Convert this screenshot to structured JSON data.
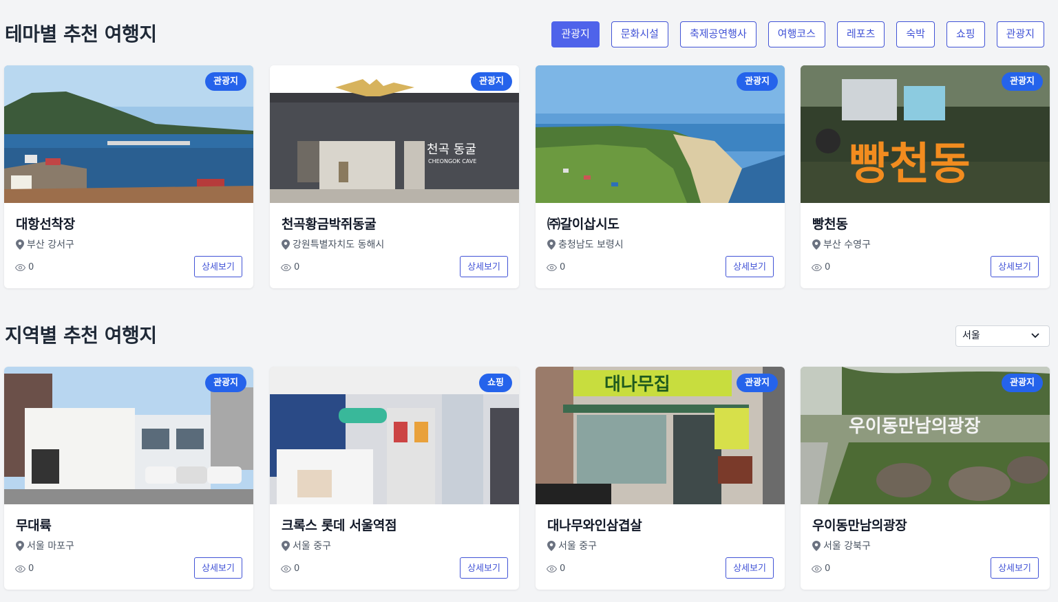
{
  "theme_section": {
    "title": "테마별 추천 여행지",
    "filters": [
      "관광지",
      "문화시설",
      "축제공연행사",
      "여행코스",
      "레포츠",
      "숙박",
      "쇼핑",
      "관광지"
    ],
    "active_filter_index": 0,
    "cards": [
      {
        "name": "대항선착장",
        "location": "부산 강서구",
        "badge": "관광지",
        "views": "0",
        "detail": "상세보기"
      },
      {
        "name": "천곡황금박쥐동굴",
        "location": "강원특별자치도 동해시",
        "badge": "관광지",
        "views": "0",
        "detail": "상세보기",
        "sign_text": "천곡 동굴",
        "sign_sub": "CHEONGOK CAVE"
      },
      {
        "name": "㈜갈이삽시도",
        "location": "충청남도 보령시",
        "badge": "관광지",
        "views": "0",
        "detail": "상세보기"
      },
      {
        "name": "빵천동",
        "location": "부산 수영구",
        "badge": "관광지",
        "views": "0",
        "detail": "상세보기",
        "sign_text": "빵천동"
      }
    ]
  },
  "region_section": {
    "title": "지역별 추천 여행지",
    "select_value": "서울",
    "cards": [
      {
        "name": "무대륙",
        "location": "서울 마포구",
        "badge": "관광지",
        "views": "0",
        "detail": "상세보기"
      },
      {
        "name": "크록스 롯데 서울역점",
        "location": "서울 중구",
        "badge": "쇼핑",
        "views": "0",
        "detail": "상세보기"
      },
      {
        "name": "대나무와인삼겹살",
        "location": "서울 중구",
        "badge": "관광지",
        "views": "0",
        "detail": "상세보기",
        "sign_text": "대나무집"
      },
      {
        "name": "우이동만남의광장",
        "location": "서울 강북구",
        "badge": "관광지",
        "views": "0",
        "detail": "상세보기",
        "sign_text": "우이동만남의광장"
      }
    ]
  },
  "colors": {
    "accent": "#4f63ea",
    "badge": "#2563eb",
    "background": "#f3f4f6"
  },
  "icons": {
    "location": "map-pin-icon",
    "views": "eye-icon",
    "select": "chevron-down-icon"
  }
}
